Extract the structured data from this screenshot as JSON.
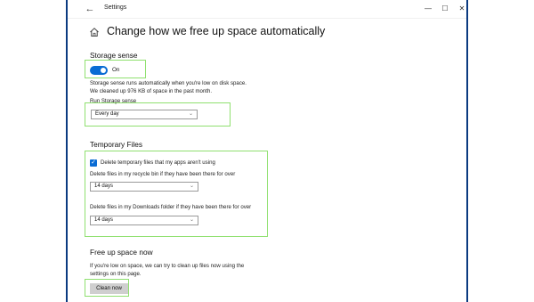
{
  "window": {
    "title": "Settings",
    "back_glyph": "←",
    "controls": {
      "minimize": "—",
      "maximize": "☐",
      "close": "✕"
    }
  },
  "header": {
    "title": "Change how we free up space automatically",
    "icon": "home-icon"
  },
  "storage_sense": {
    "section_title": "Storage sense",
    "toggle_state": "On",
    "description_line1": "Storage sense runs automatically when you're low on disk space.",
    "description_line2": "We cleaned up 976 KB of space in the past month.",
    "run_label": "Run Storage sense",
    "run_value": "Every day"
  },
  "temporary_files": {
    "section_title": "Temporary Files",
    "checkbox_label": "Delete temporary files that my apps aren't using",
    "checkbox_checked": true,
    "recycle_label": "Delete files in my recycle bin if they have been there for over",
    "recycle_value": "14 days",
    "downloads_label": "Delete files in my Downloads folder if they have been there for over",
    "downloads_value": "14 days"
  },
  "free_up": {
    "section_title": "Free up space now",
    "description_line1": "If you're low on space, we can try to clean up files now using the",
    "description_line2": "settings on this page.",
    "button_label": "Clean now"
  },
  "colors": {
    "accent": "#0a6cd4",
    "highlight": "#8fe06f",
    "frame": "#0b3a80"
  }
}
